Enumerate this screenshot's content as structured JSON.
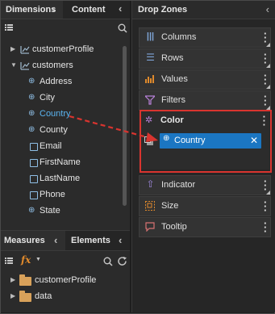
{
  "left_tabs": {
    "dimensions": "Dimensions",
    "content": "Content"
  },
  "tree": [
    {
      "label": "customerProfile",
      "type": "dimension",
      "expanded": false
    },
    {
      "label": "customers",
      "type": "dimension",
      "expanded": true
    },
    {
      "label": "Address",
      "type": "geo"
    },
    {
      "label": "City",
      "type": "geo"
    },
    {
      "label": "Country",
      "type": "geo"
    },
    {
      "label": "County",
      "type": "geo"
    },
    {
      "label": "Email",
      "type": "field"
    },
    {
      "label": "FirstName",
      "type": "field"
    },
    {
      "label": "LastName",
      "type": "field"
    },
    {
      "label": "Phone",
      "type": "field"
    },
    {
      "label": "State",
      "type": "geo"
    }
  ],
  "bottom_tabs": {
    "measures": "Measures",
    "elements": "Elements"
  },
  "measures_tree": [
    {
      "label": "customerProfile"
    },
    {
      "label": "data"
    }
  ],
  "drop_zones": {
    "title": "Drop Zones",
    "zones": [
      {
        "label": "Columns",
        "icon": "columns-icon"
      },
      {
        "label": "Rows",
        "icon": "rows-icon"
      },
      {
        "label": "Values",
        "icon": "values-icon"
      },
      {
        "label": "Filters",
        "icon": "filter-icon"
      },
      {
        "label": "Color",
        "icon": "color-icon"
      },
      {
        "label": "Indicator",
        "icon": "indicator-icon"
      },
      {
        "label": "Size",
        "icon": "size-icon"
      },
      {
        "label": "Tooltip",
        "icon": "tooltip-icon"
      }
    ],
    "color_chip": "Country"
  },
  "colors": {
    "accent": "#1b76c2",
    "highlight": "#d9342f",
    "dim_text": "#8fbfe6",
    "folder": "#d8a15a"
  }
}
